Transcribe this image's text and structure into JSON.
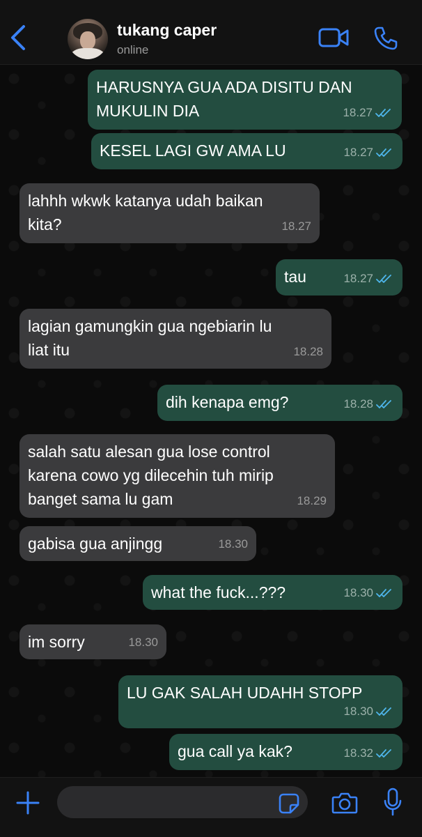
{
  "header": {
    "contact_name": "tukang caper",
    "status": "online",
    "back_icon": "chevron-left-icon",
    "video_icon": "video-camera-icon",
    "call_icon": "phone-icon"
  },
  "messages": [
    {
      "direction": "out",
      "text": "HARUSNYA GUA ADA DISITU DAN\nMUKULIN DIA",
      "time": "18.27",
      "read": true
    },
    {
      "direction": "out",
      "text": "KESEL LAGI GW AMA LU",
      "time": "18.27",
      "read": true
    },
    {
      "direction": "in",
      "text": "lahhh wkwk katanya udah baikan\nkita?",
      "time": "18.27"
    },
    {
      "direction": "out",
      "text": "tau",
      "time": "18.27",
      "read": true
    },
    {
      "direction": "in",
      "text": "lagian gamungkin gua ngebiarin lu\nliat itu",
      "time": "18.28"
    },
    {
      "direction": "out",
      "text": "dih kenapa emg?",
      "time": "18.28",
      "read": true
    },
    {
      "direction": "in",
      "text": "salah satu alesan gua lose control\nkarena cowo yg dilecehin tuh mirip\nbanget sama lu gam",
      "time": "18.29"
    },
    {
      "direction": "in",
      "text": "gabisa gua anjingg",
      "time": "18.30"
    },
    {
      "direction": "out",
      "text": "what the fuck...???",
      "time": "18.30",
      "read": true
    },
    {
      "direction": "in",
      "text": "im sorry",
      "time": "18.30"
    },
    {
      "direction": "out",
      "text": "LU GAK SALAH UDAHH STOPP",
      "time": "18.30",
      "read": true
    },
    {
      "direction": "out",
      "text": "gua call ya kak?",
      "time": "18.32",
      "read": true
    }
  ],
  "footer": {
    "input_placeholder": "",
    "plus_icon": "plus-icon",
    "sticker_icon": "sticker-icon",
    "camera_icon": "camera-icon",
    "mic_icon": "microphone-icon"
  },
  "colors": {
    "accent": "#3a82f7",
    "outgoing_bubble": "#234d40",
    "incoming_bubble": "#3b3b3d",
    "read_tick": "#4fb6ec"
  }
}
